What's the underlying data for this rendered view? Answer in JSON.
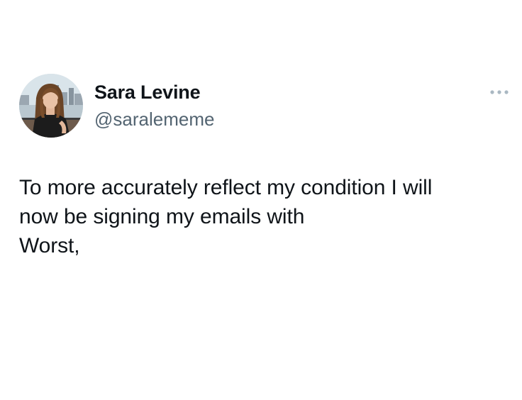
{
  "author": {
    "display_name": "Sara Levine",
    "handle": "@saralememe",
    "avatar_icon": "profile-photo"
  },
  "actions": {
    "more_icon": "more-horizontal-icon"
  },
  "tweet": {
    "lines": [
      "To more accurately reflect my condition I will",
      "now be signing my emails with",
      "Worst,"
    ]
  },
  "colors": {
    "background": "#ffffff",
    "text_primary": "#0f1419",
    "text_secondary": "#536471",
    "more_icon": "#aab8c2"
  }
}
